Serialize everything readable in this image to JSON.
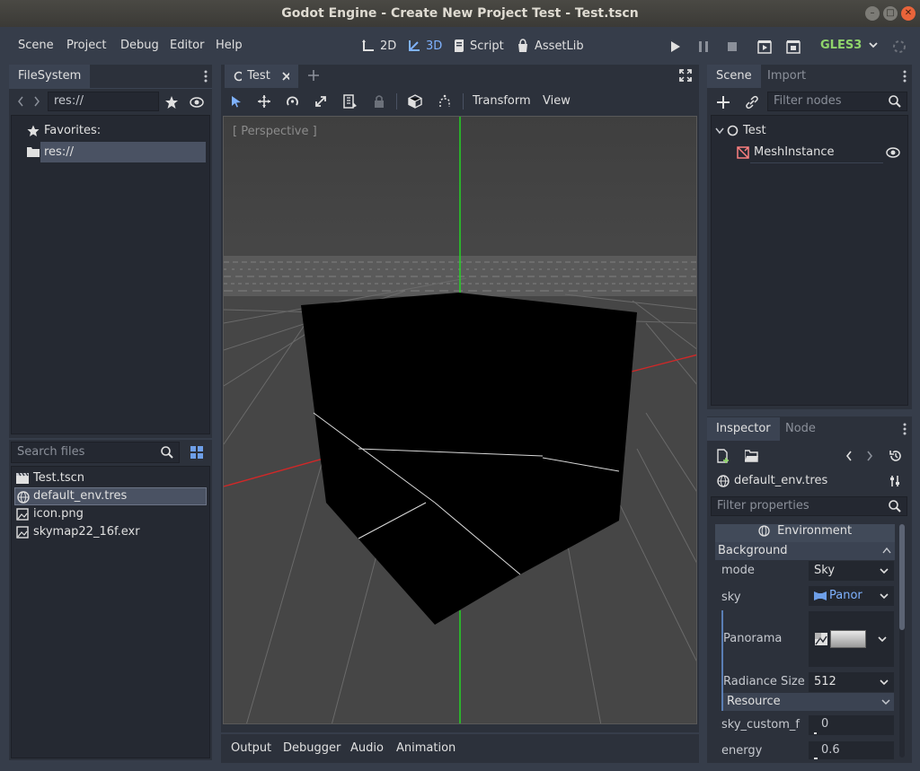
{
  "window": {
    "title": "Godot Engine - Create New Project Test - Test.tscn"
  },
  "menu": [
    "Scene",
    "Project",
    "Debug",
    "Editor",
    "Help"
  ],
  "workspaces": [
    {
      "label": "2D",
      "icon": "2d-icon"
    },
    {
      "label": "3D",
      "icon": "3d-icon"
    },
    {
      "label": "Script",
      "icon": "script-icon"
    },
    {
      "label": "AssetLib",
      "icon": "assetlib-icon"
    }
  ],
  "renderer": "GLES3",
  "colors": {
    "accent": "#7fb2ff",
    "bg": "#363d4a",
    "panel": "#2c313b",
    "viewport": "#454545",
    "x_axis": "#e02020",
    "y_axis": "#20e020"
  },
  "filesystem": {
    "tab": "FileSystem",
    "path": "res://",
    "favorites_label": "Favorites:",
    "tree_root": "res://",
    "search_placeholder": "Search files",
    "files": [
      {
        "name": "Test.tscn",
        "icon": "scene-file-icon"
      },
      {
        "name": "default_env.tres",
        "icon": "environment-file-icon"
      },
      {
        "name": "icon.png",
        "icon": "image-file-icon"
      },
      {
        "name": "skymap22_16f.exr",
        "icon": "image-file-icon"
      }
    ]
  },
  "editor_tab": {
    "label": "Test"
  },
  "viewport_toolbar": {
    "transform": "Transform",
    "view": "View"
  },
  "viewport": {
    "perspective_label": "[ Perspective ]"
  },
  "bottom_tabs": [
    "Output",
    "Debugger",
    "Audio",
    "Animation"
  ],
  "scene_dock": {
    "tabs": [
      "Scene",
      "Import"
    ],
    "filter_placeholder": "Filter nodes",
    "nodes": [
      {
        "name": "Test",
        "icon": "spatial-node-icon"
      },
      {
        "name": "MeshInstance",
        "icon": "mesh-instance-icon"
      }
    ]
  },
  "inspector": {
    "tabs": [
      "Inspector",
      "Node"
    ],
    "resource": "default_env.tres",
    "filter_placeholder": "Filter properties",
    "section": "Environment",
    "category": "Background",
    "props": {
      "mode_label": "mode",
      "mode_value": "Sky",
      "sky_label": "sky",
      "sky_value": "Panor",
      "panorama_label": "Panorama",
      "radiance_label": "Radiance Size",
      "radiance_value": "512",
      "resource_label": "Resource",
      "custom_fov_label": "sky_custom_f",
      "custom_fov_value": "0",
      "energy_label": "energy",
      "energy_value": "0.6"
    }
  }
}
